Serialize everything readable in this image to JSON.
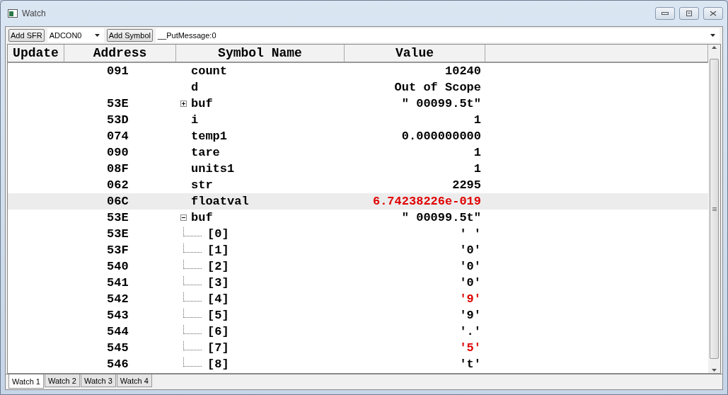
{
  "window": {
    "title": "Watch"
  },
  "toolbar": {
    "sfr_button": "Add SFR",
    "sfr_select": "ADCON0",
    "symbol_button": "Add Symbol",
    "symbol_select": "__PutMessage:0"
  },
  "table": {
    "columns": [
      "Update",
      "Address",
      "Symbol Name",
      "Value"
    ],
    "rows": [
      {
        "address": "091",
        "symbol": "count",
        "value": "10240",
        "changed": false,
        "selected": false
      },
      {
        "address": "",
        "symbol": "d",
        "value": "Out of Scope",
        "changed": false,
        "selected": false
      },
      {
        "address": "53E",
        "symbol": "buf",
        "value": "\" 00099.5t\"",
        "changed": false,
        "selected": false,
        "expanded": false
      },
      {
        "address": "53D",
        "symbol": "i",
        "value": "1",
        "changed": false,
        "selected": false
      },
      {
        "address": "074",
        "symbol": "temp1",
        "value": "0.000000000",
        "changed": false,
        "selected": false
      },
      {
        "address": "090",
        "symbol": "tare",
        "value": "1",
        "changed": false,
        "selected": false
      },
      {
        "address": "08F",
        "symbol": "units1",
        "value": "1",
        "changed": false,
        "selected": false
      },
      {
        "address": "062",
        "symbol": "str",
        "value": "2295",
        "changed": false,
        "selected": false
      },
      {
        "address": "06C",
        "symbol": "floatval",
        "value": "6.74238226e-019",
        "changed": true,
        "selected": true
      },
      {
        "address": "53E",
        "symbol": "buf",
        "value": "\" 00099.5t\"",
        "changed": false,
        "selected": false,
        "expanded": true,
        "children": [
          {
            "address": "53E",
            "symbol": "[0]",
            "value": "' '",
            "changed": false,
            "selected": false
          },
          {
            "address": "53F",
            "symbol": "[1]",
            "value": "'0'",
            "changed": false,
            "selected": false
          },
          {
            "address": "540",
            "symbol": "[2]",
            "value": "'0'",
            "changed": false,
            "selected": false
          },
          {
            "address": "541",
            "symbol": "[3]",
            "value": "'0'",
            "changed": false,
            "selected": false
          },
          {
            "address": "542",
            "symbol": "[4]",
            "value": "'9'",
            "changed": true,
            "selected": false
          },
          {
            "address": "543",
            "symbol": "[5]",
            "value": "'9'",
            "changed": false,
            "selected": false
          },
          {
            "address": "544",
            "symbol": "[6]",
            "value": "'.'",
            "changed": false,
            "selected": false
          },
          {
            "address": "545",
            "symbol": "[7]",
            "value": "'5'",
            "changed": true,
            "selected": false
          },
          {
            "address": "546",
            "symbol": "[8]",
            "value": "'t'",
            "changed": false,
            "selected": false
          }
        ]
      }
    ]
  },
  "tabs": [
    {
      "label": "Watch 1",
      "selected": true
    },
    {
      "label": "Watch 2",
      "selected": false
    },
    {
      "label": "Watch 3",
      "selected": false
    },
    {
      "label": "Watch 4",
      "selected": false
    }
  ]
}
